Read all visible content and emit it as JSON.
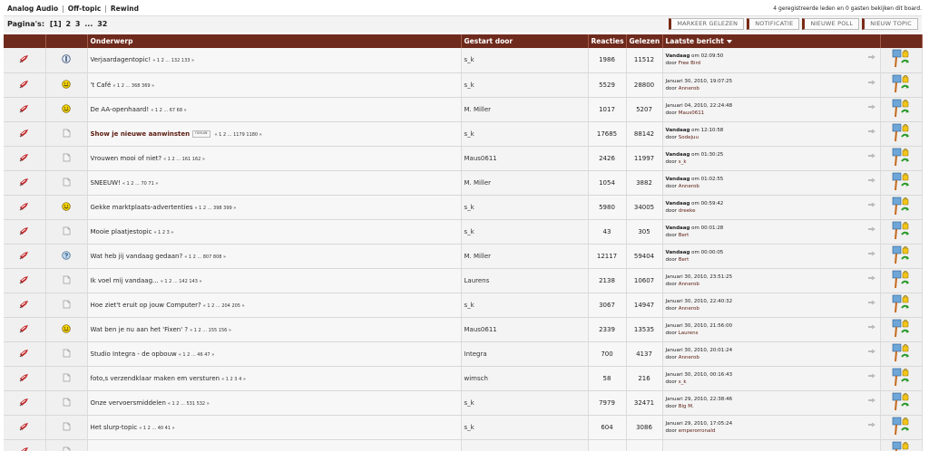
{
  "breadcrumb": {
    "items": [
      "Analog Audio",
      "Off-topic",
      "Rewind"
    ],
    "separator": "|"
  },
  "viewers_text": "4 geregistreerde leden en 0 gasten bekijken dit board.",
  "pagination": {
    "label": "Pagina's:",
    "current": "[1]",
    "pages": [
      "2",
      "3",
      "...",
      "32"
    ]
  },
  "buttons": {
    "mark_read": "Markeer gelezen",
    "notify": "Notificatie",
    "new_poll": "Nieuwe poll",
    "new_topic": "Nieuw topic"
  },
  "columns": {
    "subject": "Onderwerp",
    "started_by": "Gestart door",
    "replies": "Reacties",
    "views": "Gelezen",
    "last_post": "Laatste bericht"
  },
  "colors": {
    "header_bg": "#6e2a1c",
    "accent": "#7a2a17",
    "link_user": "#5a1a0e"
  },
  "topics": [
    {
      "icon": "pin-icon",
      "type": "info-icon",
      "subject": "Verjaardagentopic!",
      "subject_bold": false,
      "new": "",
      "subpages": "« 1 2 ... 132 133 »",
      "starter": "s_k",
      "replies": "1986",
      "views": "11512",
      "last_date_bold": "Vandaag",
      "last_date": " om 02:09:50",
      "by_label": "door",
      "last_user": "Free Bird"
    },
    {
      "icon": "pin-icon",
      "type": "grin-icon",
      "subject": "'t Café",
      "subject_bold": false,
      "new": "",
      "subpages": "« 1 2 ... 368 369 »",
      "starter": "s_k",
      "replies": "5529",
      "views": "28800",
      "last_date_bold": "",
      "last_date": "Januari 30, 2010, 19:07:25",
      "by_label": "door",
      "last_user": "Annerob"
    },
    {
      "icon": "pin-icon",
      "type": "grin-icon",
      "subject": "De AA-openhaard!",
      "subject_bold": false,
      "new": "",
      "subpages": "« 1 2 ... 67 68 »",
      "starter": "M. Miller",
      "replies": "1017",
      "views": "5207",
      "last_date_bold": "",
      "last_date": "Januari 04, 2010, 22:24:48",
      "by_label": "door",
      "last_user": "Maus0611"
    },
    {
      "icon": "pin-icon",
      "type": "doc-icon",
      "subject": "Show je nieuwe aanwinsten",
      "subject_bold": true,
      "new": "nieuw",
      "subpages": "« 1 2 ... 1179 1180 »",
      "starter": "s_k",
      "replies": "17685",
      "views": "88142",
      "last_date_bold": "Vandaag",
      "last_date": " om 12:10:58",
      "by_label": "door",
      "last_user": "Sodejuu"
    },
    {
      "icon": "pin-icon",
      "type": "doc-icon",
      "subject": "Vrouwen mooi of niet?",
      "subject_bold": false,
      "new": "",
      "subpages": "« 1 2 ... 161 162 »",
      "starter": "Maus0611",
      "replies": "2426",
      "views": "11997",
      "last_date_bold": "Vandaag",
      "last_date": " om 01:30:25",
      "by_label": "door",
      "last_user": "s_k"
    },
    {
      "icon": "pin-icon",
      "type": "doc-icon",
      "subject": "SNEEUW!",
      "subject_bold": false,
      "new": "",
      "subpages": "« 1 2 ... 70 71 »",
      "starter": "M. Miller",
      "replies": "1054",
      "views": "3882",
      "last_date_bold": "Vandaag",
      "last_date": " om 01:02:55",
      "by_label": "door",
      "last_user": "Annerob"
    },
    {
      "icon": "pin-icon",
      "type": "grin-icon",
      "subject": "Gekke marktplaats-advertenties",
      "subject_bold": false,
      "new": "",
      "subpages": "« 1 2 ... 398 399 »",
      "starter": "s_k",
      "replies": "5980",
      "views": "34005",
      "last_date_bold": "Vandaag",
      "last_date": " om 00:59:42",
      "by_label": "door",
      "last_user": "dreeke"
    },
    {
      "icon": "pin-icon",
      "type": "doc-icon",
      "subject": "Mooie plaatjestopic",
      "subject_bold": false,
      "new": "",
      "subpages": "« 1 2 3 »",
      "starter": "s_k",
      "replies": "43",
      "views": "305",
      "last_date_bold": "Vandaag",
      "last_date": " om 00:01:28",
      "by_label": "door",
      "last_user": "Bert"
    },
    {
      "icon": "pin-icon",
      "type": "question-icon",
      "subject": "Wat heb jij vandaag gedaan?",
      "subject_bold": false,
      "new": "",
      "subpages": "« 1 2 ... 807 808 »",
      "starter": "M. Miller",
      "replies": "12117",
      "views": "59404",
      "last_date_bold": "Vandaag",
      "last_date": " om 00:00:05",
      "by_label": "door",
      "last_user": "Bert"
    },
    {
      "icon": "pin-icon",
      "type": "doc-icon",
      "subject": "Ik voel mij vandaag...",
      "subject_bold": false,
      "new": "",
      "subpages": "« 1 2 ... 142 143 »",
      "starter": "Laurens",
      "replies": "2138",
      "views": "10607",
      "last_date_bold": "",
      "last_date": "Januari 30, 2010, 23:51:25",
      "by_label": "door",
      "last_user": "Annerob"
    },
    {
      "icon": "pin-icon",
      "type": "doc-icon",
      "subject": "Hoe ziet't eruit op jouw Computer?",
      "subject_bold": false,
      "new": "",
      "subpages": "« 1 2 ... 204 205 »",
      "starter": "s_k",
      "replies": "3067",
      "views": "14947",
      "last_date_bold": "",
      "last_date": "Januari 30, 2010, 22:40:32",
      "by_label": "door",
      "last_user": "Annerob"
    },
    {
      "icon": "pin-icon",
      "type": "grin-icon",
      "subject": "Wat ben je nu aan het 'Fixen' ?",
      "subject_bold": false,
      "new": "",
      "subpages": "« 1 2 ... 155 156 »",
      "starter": "Maus0611",
      "replies": "2339",
      "views": "13535",
      "last_date_bold": "",
      "last_date": "Januari 30, 2010, 21:56:00",
      "by_label": "door",
      "last_user": "Laurens"
    },
    {
      "icon": "pin-icon",
      "type": "doc-icon",
      "subject": "Studio Integra - de opbouw",
      "subject_bold": false,
      "new": "",
      "subpages": "« 1 2 ... 46 47 »",
      "starter": "Integra",
      "replies": "700",
      "views": "4137",
      "last_date_bold": "",
      "last_date": "Januari 30, 2010, 20:01:24",
      "by_label": "door",
      "last_user": "Annerob"
    },
    {
      "icon": "pin-icon",
      "type": "doc-icon",
      "subject": "foto,s verzendklaar maken em versturen",
      "subject_bold": false,
      "new": "",
      "subpages": "« 1 2 3 4 »",
      "starter": "wimsch",
      "replies": "58",
      "views": "216",
      "last_date_bold": "",
      "last_date": "Januari 30, 2010, 00:16:43",
      "by_label": "door",
      "last_user": "s_k"
    },
    {
      "icon": "pin-icon",
      "type": "doc-icon",
      "subject": "Onze vervoersmiddelen",
      "subject_bold": false,
      "new": "",
      "subpages": "« 1 2 ... 531 532 »",
      "starter": "s_k",
      "replies": "7979",
      "views": "32471",
      "last_date_bold": "",
      "last_date": "Januari 29, 2010, 22:38:46",
      "by_label": "door",
      "last_user": "Big M."
    },
    {
      "icon": "pin-icon",
      "type": "doc-icon",
      "subject": "Het slurp-topic",
      "subject_bold": false,
      "new": "",
      "subpages": "« 1 2 ... 40 41 »",
      "starter": "s_k",
      "replies": "604",
      "views": "3086",
      "last_date_bold": "",
      "last_date": "Januari 29, 2010, 17:05:24",
      "by_label": "door",
      "last_user": "emperorronald"
    },
    {
      "icon": "pin-icon",
      "type": "doc-icon",
      "subject": "",
      "subject_bold": false,
      "new": "",
      "subpages": "",
      "starter": "",
      "replies": "",
      "views": "",
      "last_date_bold": "",
      "last_date": "",
      "by_label": "",
      "last_user": ""
    }
  ]
}
